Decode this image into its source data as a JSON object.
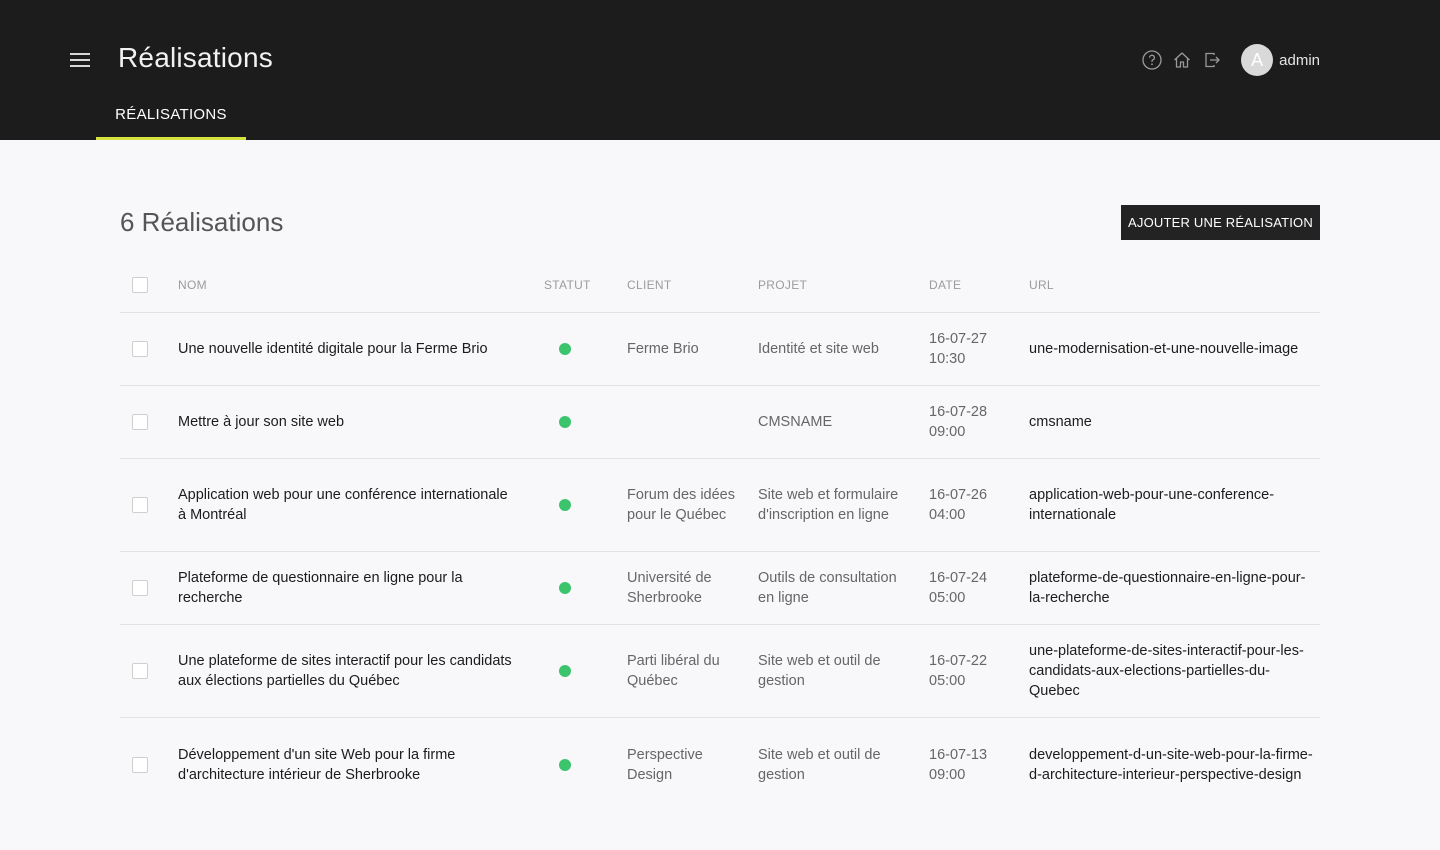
{
  "header": {
    "title": "Réalisations",
    "user": {
      "initial": "A",
      "name": "admin"
    },
    "icons": [
      "help-icon",
      "home-icon",
      "logout-icon"
    ]
  },
  "nav": {
    "tab": "RÉALISATIONS",
    "accent": "#d7e241"
  },
  "main": {
    "count_title": "6 Réalisations",
    "add_button": "AJOUTER UNE RÉALISATION"
  },
  "table": {
    "columns": {
      "name": "NOM",
      "status": "STATUT",
      "client": "CLIENT",
      "project": "PROJET",
      "date": "DATE",
      "url": "URL"
    },
    "status_color": "#3cc46d",
    "rows": [
      {
        "name": "Une nouvelle identité digitale pour la Ferme Brio",
        "client": "Ferme Brio",
        "project": "Identité et site web",
        "date": "16-07-27",
        "time": "10:30",
        "url": "une-modernisation-et-une-nouvelle-image"
      },
      {
        "name": "Mettre à jour son site web",
        "client": "",
        "project": "CMSNAME",
        "date": "16-07-28",
        "time": "09:00",
        "url": "cmsname"
      },
      {
        "name": "Application web pour une conférence internationale à Montréal",
        "client": "Forum des idées pour le Québec",
        "project": "Site web et formulaire d'inscription en ligne",
        "date": "16-07-26",
        "time": "04:00",
        "url": "application-web-pour-une-conference-internationale"
      },
      {
        "name": "Plateforme de questionnaire en ligne pour la recherche",
        "client": "Université de Sherbrooke",
        "project": "Outils de consultation en ligne",
        "date": "16-07-24",
        "time": "05:00",
        "url": "plateforme-de-questionnaire-en-ligne-pour-la-recherche"
      },
      {
        "name": "Une plateforme de sites interactif pour les candidats aux élections partielles du Québec",
        "client": "Parti libéral du Québec",
        "project": "Site web et outil de gestion",
        "date": "16-07-22",
        "time": "05:00",
        "url": "une-plateforme-de-sites-interactif-pour-les-candidats-aux-elections-partielles-du-Quebec"
      },
      {
        "name": "Développement d'un site Web pour la firme d'architecture intérieur de Sherbrooke",
        "client": "Perspective Design",
        "project": "Site web et outil de gestion",
        "date": "16-07-13",
        "time": "09:00",
        "url": "developpement-d-un-site-web-pour-la-firme-d-architecture-interieur-perspective-design"
      }
    ]
  }
}
